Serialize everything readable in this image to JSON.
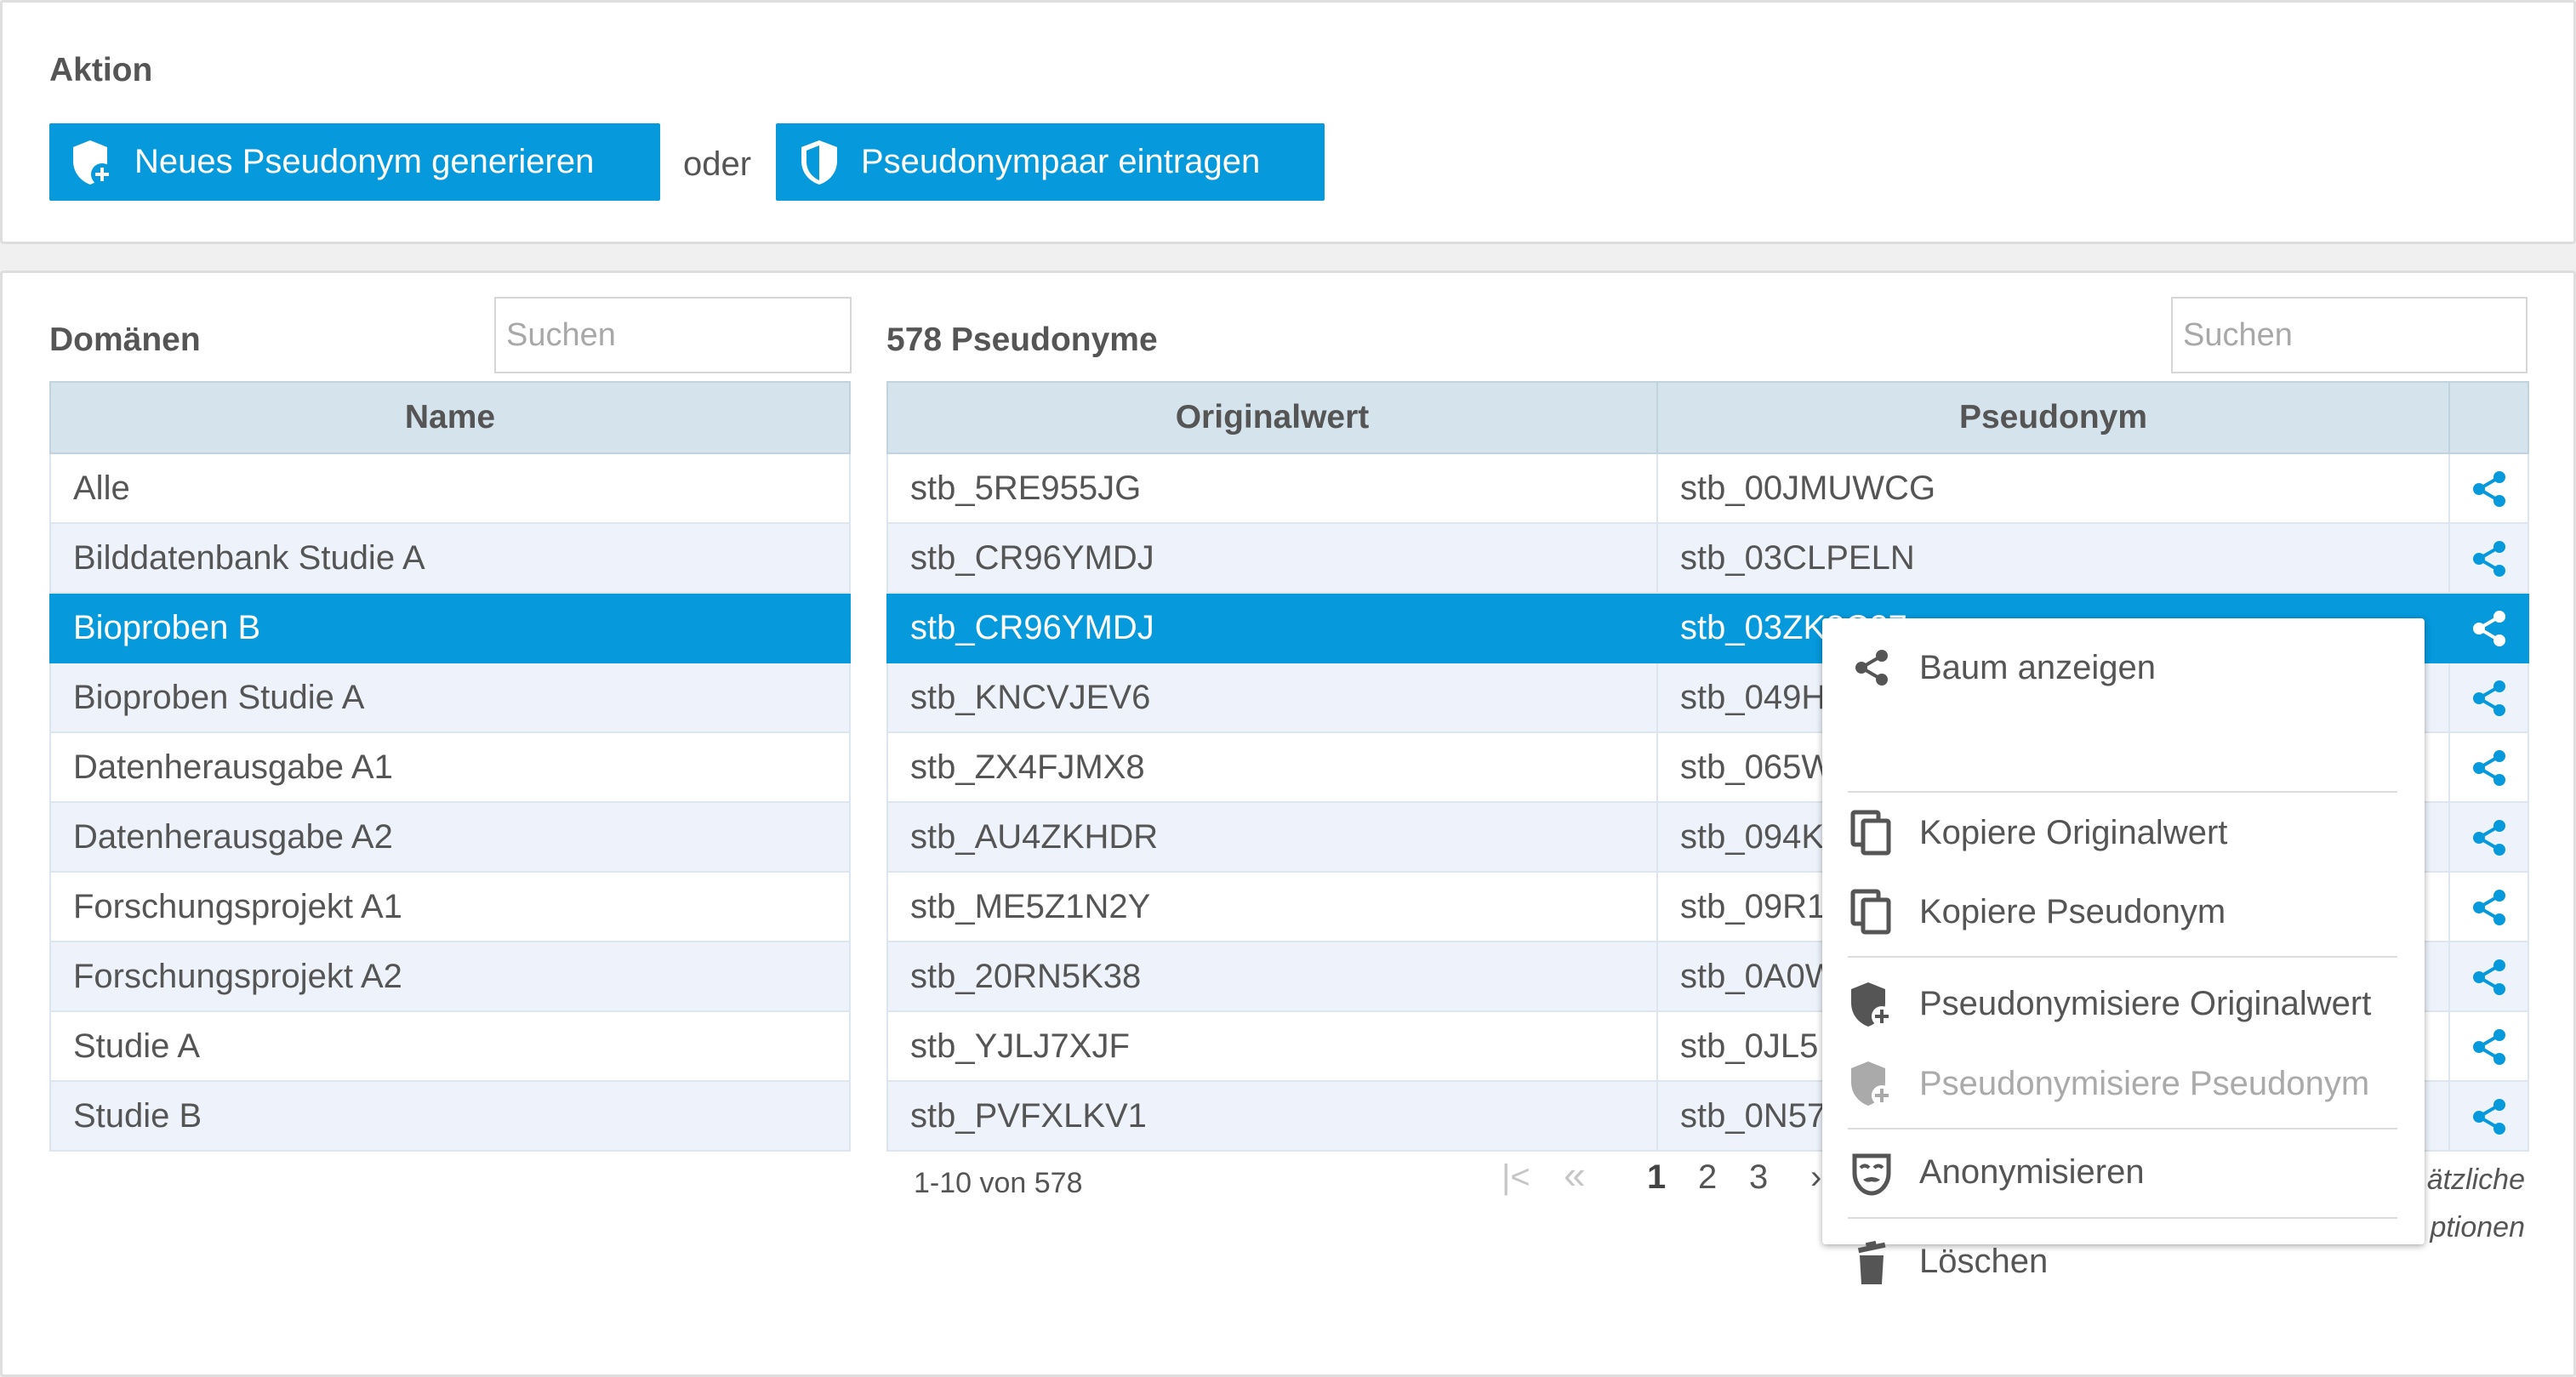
{
  "action": {
    "title": "Aktion",
    "new_pseudonym_button": "Neues Pseudonym generieren",
    "or_label": "oder",
    "pair_button": "Pseudonympaar eintragen"
  },
  "domains": {
    "title": "Domänen",
    "search_placeholder": "Suchen",
    "column_name": "Name",
    "rows": [
      "Alle",
      "Bilddatenbank Studie A",
      "Bioproben B",
      "Bioproben Studie A",
      "Datenherausgabe A1",
      "Datenherausgabe A2",
      "Forschungsprojekt A1",
      "Forschungsprojekt A2",
      "Studie A",
      "Studie B"
    ],
    "selected_index": 2
  },
  "pseudonyms": {
    "title": "578 Pseudonyme",
    "search_placeholder": "Suchen",
    "column_original": "Originalwert",
    "column_pseudonym": "Pseudonym",
    "selected_index": 2,
    "rows": [
      {
        "original": "stb_5RE955JG",
        "pseudonym": "stb_00JMUWCG"
      },
      {
        "original": "stb_CR96YMDJ",
        "pseudonym": "stb_03CLPELN"
      },
      {
        "original": "stb_CR96YMDJ",
        "pseudonym": "stb_03ZK8C27"
      },
      {
        "original": "stb_KNCVJEV6",
        "pseudonym": "stb_049H"
      },
      {
        "original": "stb_ZX4FJMX8",
        "pseudonym": "stb_065W"
      },
      {
        "original": "stb_AU4ZKHDR",
        "pseudonym": "stb_094K"
      },
      {
        "original": "stb_ME5Z1N2Y",
        "pseudonym": "stb_09R1"
      },
      {
        "original": "stb_20RN5K38",
        "pseudonym": "stb_0A0W"
      },
      {
        "original": "stb_YJLJ7XJF",
        "pseudonym": "stb_0JL5"
      },
      {
        "original": "stb_PVFXLKV1",
        "pseudonym": "stb_0N57"
      }
    ]
  },
  "pagination": {
    "info": "1-10 von 578",
    "first": "|<",
    "prev": "«",
    "pages": [
      "1",
      "2",
      "3"
    ],
    "current_page": "1",
    "next": "›"
  },
  "more_options": {
    "line1": "ätzliche",
    "line2": "ptionen"
  },
  "context_menu": {
    "items": [
      {
        "label": "Baum anzeigen",
        "icon": "share-icon",
        "enabled": true
      },
      {
        "label": "Kopiere Originalwert",
        "icon": "copy-icon",
        "enabled": true
      },
      {
        "label": "Kopiere Pseudonym",
        "icon": "copy-icon",
        "enabled": true
      },
      {
        "label": "Pseudonymisiere Originalwert",
        "icon": "shield-plus-icon",
        "enabled": true
      },
      {
        "label": "Pseudonymisiere Pseudonym",
        "icon": "shield-plus-icon",
        "enabled": false
      },
      {
        "label": "Anonymisieren",
        "icon": "mask-icon",
        "enabled": true
      },
      {
        "label": "Löschen",
        "icon": "trash-icon",
        "enabled": true
      }
    ]
  },
  "colors": {
    "accent": "#0699dc",
    "header_bg": "#d5e3ec",
    "row_alt": "#eef3fb",
    "text": "#555555"
  }
}
